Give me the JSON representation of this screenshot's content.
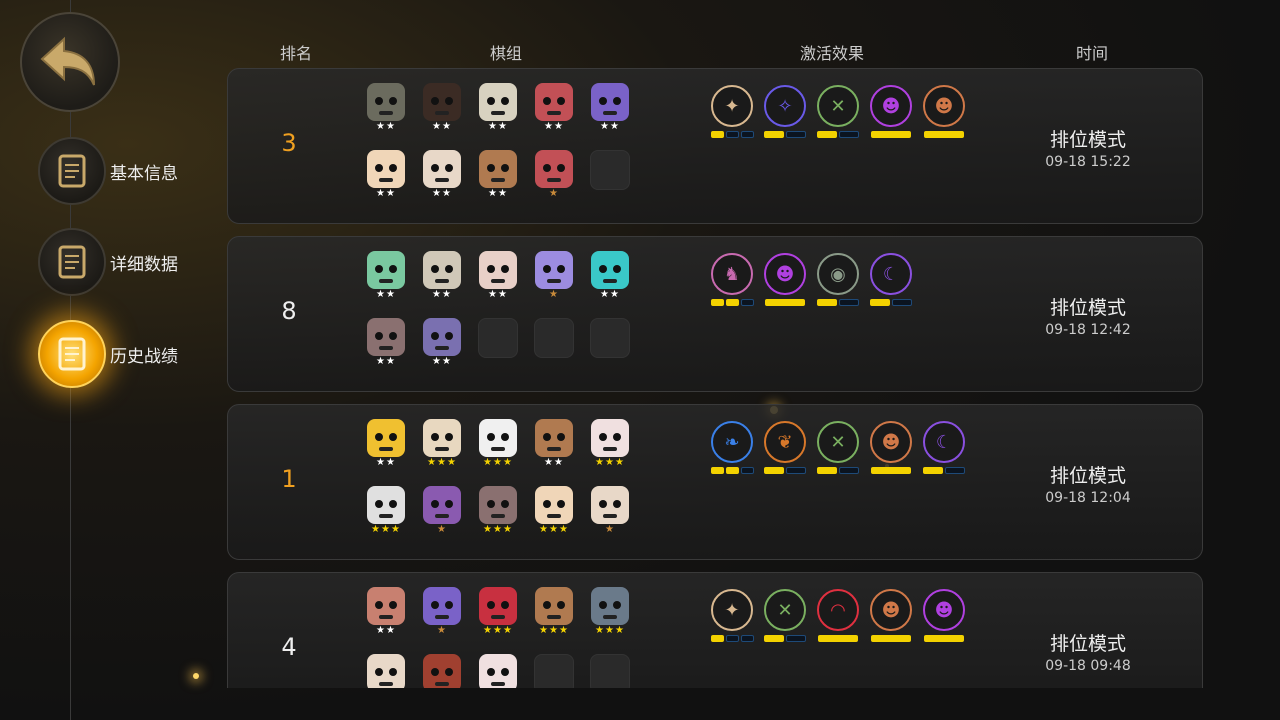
{
  "nav": {
    "back_icon": "back-arrow-icon",
    "items": [
      {
        "label": "基本信息",
        "icon": "document-icon",
        "active": false
      },
      {
        "label": "详细数据",
        "icon": "info-doc-icon",
        "active": false
      },
      {
        "label": "历史战绩",
        "icon": "history-doc-icon",
        "active": true
      }
    ]
  },
  "header": {
    "rank": "排名",
    "lineup": "棋组",
    "effects": "激活效果",
    "time": "时间"
  },
  "colors": {
    "gold_rank": "#f0a020",
    "white_rank": "#eeeeee",
    "bar_active": "#f3d200"
  },
  "matches": [
    {
      "rank": "3",
      "rank_color": "#f0a020",
      "mode": "排位模式",
      "time": "09-18 15:22",
      "units": [
        {
          "icon": "hooded-unit-icon",
          "color": "#6b6b5e",
          "stars": "★★",
          "star_color": "#ffffff"
        },
        {
          "icon": "pirate-unit-icon",
          "color": "#3b2b24",
          "stars": "★★",
          "star_color": "#ffffff"
        },
        {
          "icon": "goggles-unit-icon",
          "color": "#d8d2c0",
          "stars": "★★",
          "star_color": "#ffffff"
        },
        {
          "icon": "horned-unit-icon",
          "color": "#c25056",
          "stars": "★★",
          "star_color": "#ffffff"
        },
        {
          "icon": "purple-hair-unit-icon",
          "color": "#7a62c8",
          "stars": "★★",
          "star_color": "#ffffff"
        },
        {
          "icon": "mohawk-unit-icon",
          "color": "#f0d6b8",
          "stars": "★★",
          "star_color": "#ffffff"
        },
        {
          "icon": "skull-unit-icon",
          "color": "#e8d8c8",
          "stars": "★★",
          "star_color": "#ffffff"
        },
        {
          "icon": "sunglasses-unit-icon",
          "color": "#b07a50",
          "stars": "★★",
          "star_color": "#ffffff"
        },
        {
          "icon": "horned-unit-icon",
          "color": "#c25056",
          "stars": "★",
          "star_color": "#c88a3a"
        },
        {
          "icon": "empty-slot",
          "color": "",
          "stars": "",
          "star_color": "#ffffff"
        }
      ],
      "synergies": [
        {
          "icon": "beast-icon",
          "color": "#d8b890",
          "bars": [
            1,
            0,
            0
          ]
        },
        {
          "icon": "fish-icon",
          "color": "#6a5ae8",
          "bars": [
            1,
            0
          ]
        },
        {
          "icon": "crossbow-icon",
          "color": "#7ab060",
          "bars": [
            1,
            0
          ]
        },
        {
          "icon": "demon-icon",
          "color": "#b040e0",
          "bars": [
            1
          ]
        },
        {
          "icon": "ogre-icon",
          "color": "#d07848",
          "bars": [
            1
          ]
        }
      ]
    },
    {
      "rank": "8",
      "rank_color": "#eeeeee",
      "mode": "排位模式",
      "time": "09-18 12:42",
      "units": [
        {
          "icon": "frog-unit-icon",
          "color": "#7ac8a0",
          "stars": "★★",
          "star_color": "#ffffff"
        },
        {
          "icon": "samurai-unit-icon",
          "color": "#d0c8b8",
          "stars": "★★",
          "star_color": "#ffffff"
        },
        {
          "icon": "masked-unit-icon",
          "color": "#e8d0c8",
          "stars": "★★",
          "star_color": "#ffffff"
        },
        {
          "icon": "mech-unit-icon",
          "color": "#9c8ce0",
          "stars": "★",
          "star_color": "#c88a3a"
        },
        {
          "icon": "cyber-unit-icon",
          "color": "#3ac8c8",
          "stars": "★★",
          "star_color": "#ffffff"
        },
        {
          "icon": "ghost-unit-icon",
          "color": "#8a7070",
          "stars": "★★",
          "star_color": "#ffffff"
        },
        {
          "icon": "bat-unit-icon",
          "color": "#7a70b0",
          "stars": "★★",
          "star_color": "#ffffff"
        },
        {
          "icon": "empty-slot",
          "color": "",
          "stars": "",
          "star_color": "#ffffff"
        },
        {
          "icon": "empty-slot",
          "color": "",
          "stars": "",
          "star_color": "#ffffff"
        },
        {
          "icon": "empty-slot",
          "color": "",
          "stars": "",
          "star_color": "#ffffff"
        }
      ],
      "synergies": [
        {
          "icon": "knight-icon",
          "color": "#c86ab0",
          "bars": [
            1,
            1,
            0
          ]
        },
        {
          "icon": "demon-icon",
          "color": "#b040e0",
          "bars": [
            1
          ]
        },
        {
          "icon": "alien-icon",
          "color": "#8a9a88",
          "bars": [
            1,
            0
          ]
        },
        {
          "icon": "witch-icon",
          "color": "#8a50e0",
          "bars": [
            1,
            0
          ]
        }
      ]
    },
    {
      "rank": "1",
      "rank_color": "#f0a020",
      "mode": "排位模式",
      "time": "09-18 12:04",
      "units": [
        {
          "icon": "helmet-unit-icon",
          "color": "#f0c030",
          "stars": "★★",
          "star_color": "#ffffff"
        },
        {
          "icon": "cowboy-unit-icon",
          "color": "#e8d8c0",
          "stars": "★★★",
          "star_color": "#f3d200"
        },
        {
          "icon": "bull-unit-icon",
          "color": "#f0f0f0",
          "stars": "★★★",
          "star_color": "#f3d200"
        },
        {
          "icon": "sunglasses-unit-icon",
          "color": "#b07a50",
          "stars": "★★",
          "star_color": "#ffffff"
        },
        {
          "icon": "chef-unit-icon",
          "color": "#f0e0e0",
          "stars": "★★★",
          "star_color": "#f3d200"
        },
        {
          "icon": "ram-unit-icon",
          "color": "#e0e0e0",
          "stars": "★★★",
          "star_color": "#f3d200"
        },
        {
          "icon": "box-unit-icon",
          "color": "#8a5ab0",
          "stars": "★",
          "star_color": "#c88a3a"
        },
        {
          "icon": "ghost-unit-icon",
          "color": "#8a7070",
          "stars": "★★★",
          "star_color": "#f3d200"
        },
        {
          "icon": "mohawk-unit-icon",
          "color": "#f0d6b8",
          "stars": "★★★",
          "star_color": "#f3d200"
        },
        {
          "icon": "skull-unit-icon",
          "color": "#e8d8c8",
          "stars": "★",
          "star_color": "#c88a3a"
        }
      ],
      "synergies": [
        {
          "icon": "feather-icon",
          "color": "#3a80e8",
          "bars": [
            1,
            1,
            0
          ]
        },
        {
          "icon": "leaf-icon",
          "color": "#d8782a",
          "bars": [
            1,
            0
          ]
        },
        {
          "icon": "crossbow-icon",
          "color": "#7ab060",
          "bars": [
            1,
            0
          ]
        },
        {
          "icon": "ogre-icon",
          "color": "#d07848",
          "bars": [
            1
          ]
        },
        {
          "icon": "witch-icon",
          "color": "#8a50e0",
          "bars": [
            1,
            0
          ]
        }
      ]
    },
    {
      "rank": "4",
      "rank_color": "#eeeeee",
      "mode": "排位模式",
      "time": "09-18 09:48",
      "units": [
        {
          "icon": "screaming-unit-icon",
          "color": "#c88070",
          "stars": "★★",
          "star_color": "#ffffff"
        },
        {
          "icon": "purple-hair-unit-icon",
          "color": "#7a62c8",
          "stars": "★",
          "star_color": "#c88a3a"
        },
        {
          "icon": "red-cap-unit-icon",
          "color": "#c83040",
          "stars": "★★★",
          "star_color": "#f3d200"
        },
        {
          "icon": "sunglasses-unit-icon",
          "color": "#b07a50",
          "stars": "★★★",
          "star_color": "#f3d200"
        },
        {
          "icon": "knight-unit-icon",
          "color": "#6a7a8a",
          "stars": "★★★",
          "star_color": "#f3d200"
        },
        {
          "icon": "skull-unit-icon",
          "color": "#e8d8c8",
          "stars": "",
          "star_color": "#ffffff"
        },
        {
          "icon": "bearded-unit-icon",
          "color": "#a04030",
          "stars": "",
          "star_color": "#ffffff"
        },
        {
          "icon": "chef-unit-icon",
          "color": "#f0e0e0",
          "stars": "",
          "star_color": "#ffffff"
        },
        {
          "icon": "empty-slot",
          "color": "",
          "stars": "",
          "star_color": "#ffffff"
        },
        {
          "icon": "empty-slot",
          "color": "",
          "stars": "",
          "star_color": "#ffffff"
        }
      ],
      "synergies": [
        {
          "icon": "beast-icon",
          "color": "#d8b890",
          "bars": [
            1,
            0,
            0
          ]
        },
        {
          "icon": "crossbow-icon",
          "color": "#7ab060",
          "bars": [
            1,
            0
          ]
        },
        {
          "icon": "dome-icon",
          "color": "#e03040",
          "bars": [
            1
          ]
        },
        {
          "icon": "ogre-icon",
          "color": "#d07848",
          "bars": [
            1
          ]
        },
        {
          "icon": "demon-icon",
          "color": "#b040e0",
          "bars": [
            1
          ]
        }
      ]
    }
  ]
}
